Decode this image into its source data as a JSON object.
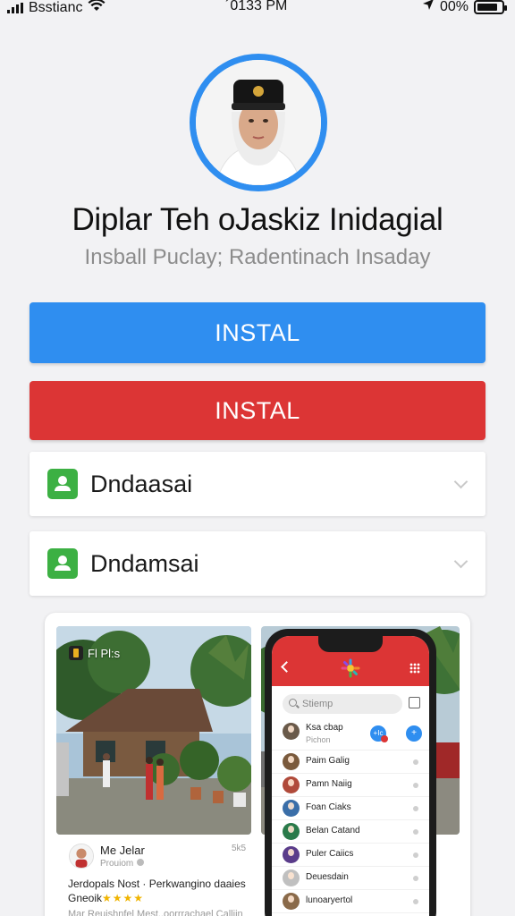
{
  "status_bar": {
    "carrier": "Bsstianc",
    "time": "´0133 PM",
    "battery_text": "00%",
    "battery_level": 0.85
  },
  "profile": {
    "title": "Diplar Teh oJaskiz Inidagial",
    "subtitle": "Insball Puclay; Radentinach Insaday"
  },
  "buttons": {
    "primary_label": "INSTAL",
    "secondary_label": "INSTAL"
  },
  "expand_rows": [
    {
      "label": "Dndaasai",
      "icon": "app-user-icon"
    },
    {
      "label": "Dndamsai",
      "icon": "app-user-icon"
    }
  ],
  "preview": {
    "left_shot": {
      "badge": "Fl Pl:s"
    },
    "post": {
      "author": "Me Jelar",
      "meta": "Prouiom",
      "time": "5k5",
      "text_line1": "Jerdopals Nost · Perkwangino daaies",
      "text_line2": "Gneoik",
      "stars": "★★★★",
      "text_line3": "Mar Reuishnfel Mest..oorrrachael Calliin"
    },
    "phone": {
      "search_placeholder": "Stiemp",
      "first_item": {
        "name": "Ksa cbap",
        "sub": "Pichon",
        "badge1": "+Ic",
        "badge2": "+"
      },
      "items": [
        {
          "name": "Paim Galig",
          "color": "#7a5a3c"
        },
        {
          "name": "Pamn Naiig",
          "color": "#b04a3a"
        },
        {
          "name": "Foan Ciaks",
          "color": "#3a6ea8"
        },
        {
          "name": "Belan Catand",
          "color": "#2a7a4a"
        },
        {
          "name": "Puler Caiics",
          "color": "#5a3c8a"
        },
        {
          "name": "Deuesdain",
          "color": "#c0c0c0"
        },
        {
          "name": "lunoaryertol",
          "color": "#8a6a4a"
        }
      ]
    }
  },
  "colors": {
    "accent_blue": "#2f8ef0",
    "accent_red": "#dc3535",
    "green_icon": "#3cb043",
    "background": "#f2f2f4"
  }
}
